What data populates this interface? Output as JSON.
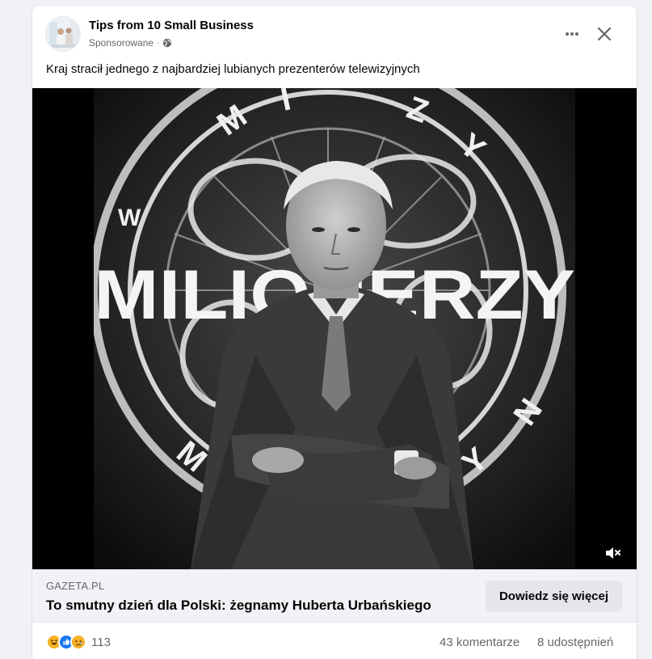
{
  "post": {
    "author": "Tips from 10 Small Business",
    "sponsored_label": "Sponsorowane",
    "separator": "·",
    "text": "Kraj stracił jednego z najbardziej lubianych prezenterów telewizyjnych",
    "media": {
      "show_logo_text": "MILIONERZY",
      "control_icons": [
        "more-horizontal-icon",
        "close-icon",
        "volume-muted-icon",
        "globe-icon"
      ]
    },
    "link": {
      "domain": "GAZETA.PL",
      "title": "To smutny dzień dla Polski: żegnamy Huberta Urbańskiego",
      "cta_label": "Dowiedz się więcej"
    },
    "stats": {
      "reaction_icons": [
        "haha-icon",
        "like-icon",
        "sad-icon"
      ],
      "reaction_count": "113",
      "comments": "43 komentarze",
      "shares": "8 udostępnień"
    }
  },
  "colors": {
    "like": "#1877f2",
    "emoji": "#f7b125",
    "secondary_text": "#65676b",
    "button_bg": "#e4e6eb"
  }
}
